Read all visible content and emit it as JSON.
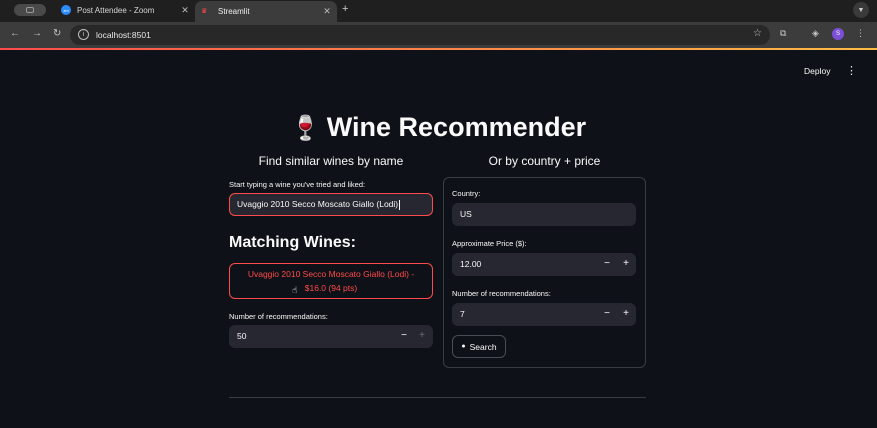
{
  "browser": {
    "tabs": [
      {
        "label": "Post Attendee - Zoom",
        "icon": "zoom-icon"
      },
      {
        "label": "Streamlit",
        "icon": "streamlit-icon"
      }
    ],
    "new_tab": "+",
    "url": "localhost:8501",
    "profile_initial": "S"
  },
  "app": {
    "deploy_label": "Deploy",
    "title": "Wine Recommender",
    "title_emoji": "🍷",
    "left": {
      "heading": "Find similar wines by name",
      "input_label": "Start typing a wine you've tried and liked:",
      "input_value": "Uvaggio 2010 Secco Moscato Giallo (Lodi)",
      "matching_header": "Matching Wines:",
      "match_line1": "Uvaggio 2010 Secco Moscato Giallo (Lodi) -",
      "match_line2": "$16.0 (94 pts)",
      "num_label": "Number of recommendations:",
      "num_value": "50"
    },
    "right": {
      "heading": "Or by country + price",
      "country_label": "Country:",
      "country_value": "US",
      "price_label": "Approximate Price ($):",
      "price_value": "12.00",
      "num_label": "Number of recommendations:",
      "num_value": "7",
      "search_label": "Search"
    }
  },
  "colors": {
    "background": "#0e1117",
    "accent": "#ff4b4b",
    "input_bg": "#262730"
  }
}
